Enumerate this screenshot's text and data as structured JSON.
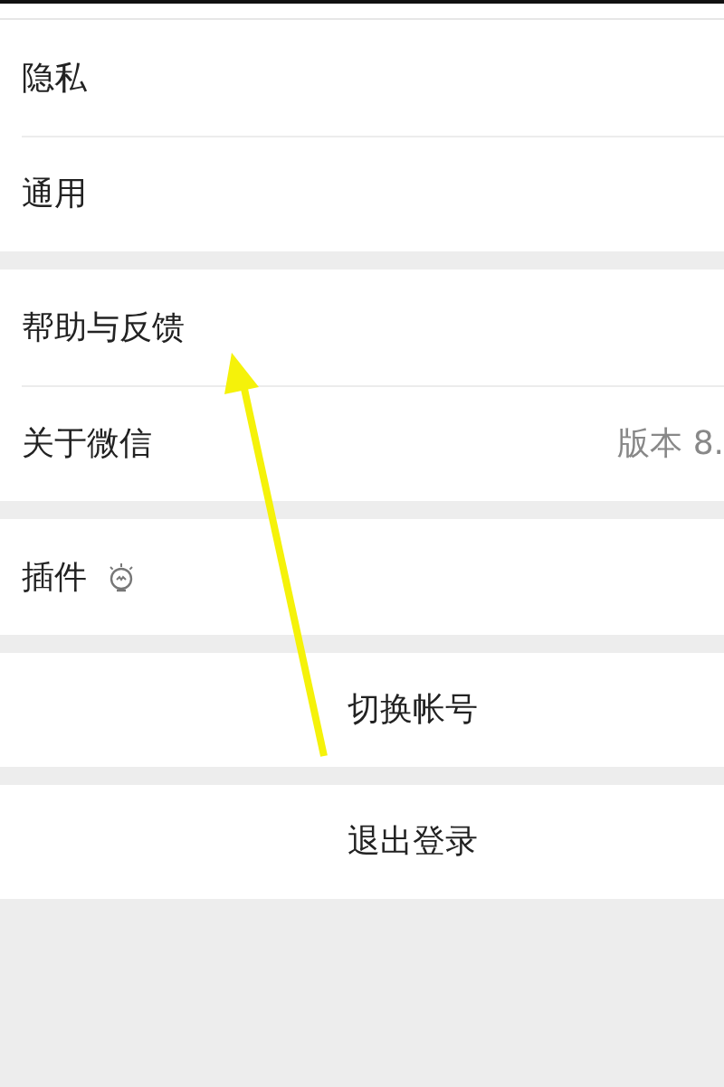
{
  "groups": [
    {
      "items": [
        {
          "kind": "row",
          "label": "隐私"
        },
        {
          "kind": "row",
          "label": "通用"
        }
      ]
    },
    {
      "items": [
        {
          "kind": "row",
          "label": "帮助与反馈"
        },
        {
          "kind": "row",
          "label": "关于微信",
          "value": "版本 8."
        }
      ]
    },
    {
      "items": [
        {
          "kind": "icon-row",
          "label": "插件"
        }
      ]
    },
    {
      "items": [
        {
          "kind": "button",
          "label": "切换帐号"
        }
      ]
    },
    {
      "items": [
        {
          "kind": "button",
          "label": "退出登录"
        }
      ]
    }
  ],
  "annotation": {
    "kind": "arrow"
  }
}
